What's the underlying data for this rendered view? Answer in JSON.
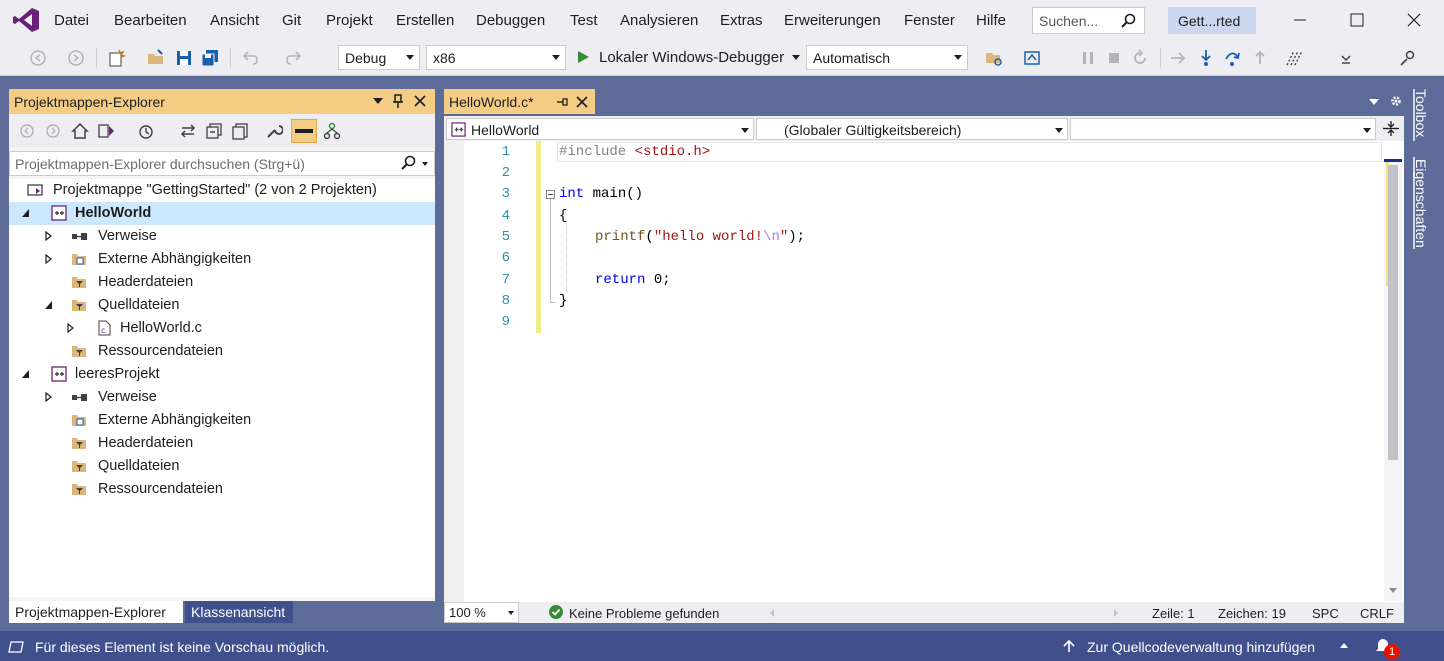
{
  "menu": {
    "items": [
      "Datei",
      "Bearbeiten",
      "Ansicht",
      "Git",
      "Projekt",
      "Erstellen",
      "Debuggen",
      "Test",
      "Analysieren",
      "Extras",
      "Erweiterungen",
      "Fenster",
      "Hilfe"
    ],
    "search_placeholder": "Suchen...",
    "solution_badge": "Gett...rted"
  },
  "toolbar": {
    "configuration": "Debug",
    "platform": "x86",
    "start_label": "Lokaler Windows-Debugger",
    "target": "Automatisch"
  },
  "solution_explorer": {
    "title": "Projektmappen-Explorer",
    "search_placeholder": "Projektmappen-Explorer durchsuchen (Strg+ü)",
    "tree": [
      {
        "label": "Projektmappe \"GettingStarted\" (2 von 2 Projekten)",
        "icon": "solution-icon",
        "expander": "none"
      },
      {
        "label": "HelloWorld",
        "icon": "cpp-project-icon",
        "expander": "expanded",
        "bold": true,
        "selected": true
      },
      {
        "label": "Verweise",
        "icon": "references-icon",
        "expander": "collapsed"
      },
      {
        "label": "Externe Abhängigkeiten",
        "icon": "external-deps-icon",
        "expander": "collapsed"
      },
      {
        "label": "Headerdateien",
        "icon": "filter-folder-icon",
        "expander": "none"
      },
      {
        "label": "Quelldateien",
        "icon": "filter-folder-icon",
        "expander": "expanded"
      },
      {
        "label": "HelloWorld.c",
        "icon": "c-file-icon",
        "expander": "collapsed"
      },
      {
        "label": "Ressourcendateien",
        "icon": "filter-folder-icon",
        "expander": "none"
      },
      {
        "label": "leeresProjekt",
        "icon": "cpp-project-icon",
        "expander": "expanded"
      },
      {
        "label": "Verweise",
        "icon": "references-icon",
        "expander": "collapsed"
      },
      {
        "label": "Externe Abhängigkeiten",
        "icon": "external-deps-icon",
        "expander": "none"
      },
      {
        "label": "Headerdateien",
        "icon": "filter-folder-icon",
        "expander": "none"
      },
      {
        "label": "Quelldateien",
        "icon": "filter-folder-icon",
        "expander": "none"
      },
      {
        "label": "Ressourcendateien",
        "icon": "filter-folder-icon",
        "expander": "none"
      }
    ],
    "tabs": [
      "Projektmappen-Explorer",
      "Klassenansicht"
    ]
  },
  "editor": {
    "tab_label": "HelloWorld.c*",
    "nav_project": "HelloWorld",
    "nav_scope": "(Globaler Gültigkeitsbereich)",
    "nav_member": "",
    "line_numbers": [
      "1",
      "2",
      "3",
      "4",
      "5",
      "6",
      "7",
      "8",
      "9"
    ],
    "code": {
      "l1_directive": "#include",
      "l1_header": "<stdio.h>",
      "l3_type": "int",
      "l3_rest": " main()",
      "l4": "{",
      "l5_fn": "printf",
      "l5_open": "(",
      "l5_str1": "\"hello world!",
      "l5_esc": "\\n",
      "l5_str2": "\"",
      "l5_close": ");",
      "l7_kw": "return",
      "l7_rest": " 0;",
      "l8": "}"
    },
    "zoom": "100 %",
    "issues": "Keine Probleme gefunden",
    "line": "Zeile: 1",
    "char": "Zeichen: 19",
    "whitespace": "SPC",
    "line_ending": "CRLF"
  },
  "rail": {
    "toolbox": "Toolbox",
    "properties": "Eigenschaften"
  },
  "statusbar": {
    "message": "Für dieses Element ist keine Vorschau möglich.",
    "source_control": "Zur Quellcodeverwaltung hinzufügen",
    "notification_count": "1"
  },
  "colors": {
    "accent": "#f5cc84",
    "frame": "#5d6b99",
    "status": "#40508d",
    "selection": "#cce8ff"
  }
}
